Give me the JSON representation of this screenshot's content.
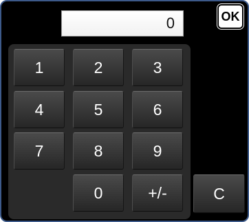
{
  "display": {
    "value": "0"
  },
  "actions": {
    "ok_label": "OK",
    "clear_label": "C"
  },
  "keypad": {
    "keys": [
      "1",
      "2",
      "3",
      "4",
      "5",
      "6",
      "7",
      "8",
      "9",
      "0",
      "+/-"
    ]
  }
}
